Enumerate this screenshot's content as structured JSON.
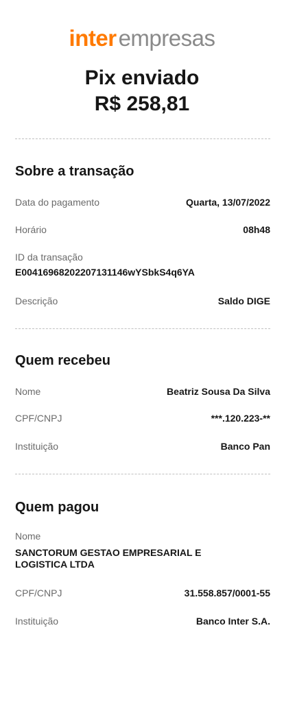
{
  "logo": {
    "brand": "inter",
    "suffix": "empresas"
  },
  "header": {
    "title": "Pix enviado",
    "amount": "R$ 258,81"
  },
  "transaction": {
    "title": "Sobre a transação",
    "date_label": "Data do pagamento",
    "date_value": "Quarta, 13/07/2022",
    "time_label": "Horário",
    "time_value": "08h48",
    "id_label": "ID da transação",
    "id_value": "E00416968202207131146wYSbkS4q6YA",
    "desc_label": "Descrição",
    "desc_value": "Saldo DIGE"
  },
  "receiver": {
    "title": "Quem recebeu",
    "name_label": "Nome",
    "name_value": "Beatriz Sousa Da Silva",
    "doc_label": "CPF/CNPJ",
    "doc_value": "***.120.223-**",
    "inst_label": "Instituição",
    "inst_value": "Banco Pan"
  },
  "payer": {
    "title": "Quem pagou",
    "name_label": "Nome",
    "name_value": "SANCTORUM GESTAO EMPRESARIAL E LOGISTICA LTDA",
    "doc_label": "CPF/CNPJ",
    "doc_value": "31.558.857/0001-55",
    "inst_label": "Instituição",
    "inst_value": "Banco Inter S.A."
  },
  "colors": {
    "brand": "#ff7a00",
    "text": "#161616",
    "muted": "#6a6a6a",
    "divider": "#bfbfbf"
  }
}
